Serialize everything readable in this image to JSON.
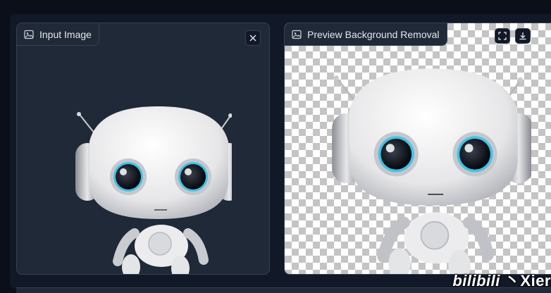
{
  "input_panel": {
    "label": "Input Image",
    "label_icon": "image-icon",
    "close_icon": "close-icon"
  },
  "preview_panel": {
    "label": "Preview Background Removal",
    "label_icon": "image-icon",
    "fullscreen_icon": "fullscreen-icon",
    "download_icon": "download-icon"
  },
  "watermark": {
    "logo": "bilibili",
    "separator": "丶",
    "name": "Xier"
  },
  "colors": {
    "background": "#0b0f19",
    "panel": "#1f2937",
    "border": "#374151",
    "text": "#e5e7eb"
  }
}
